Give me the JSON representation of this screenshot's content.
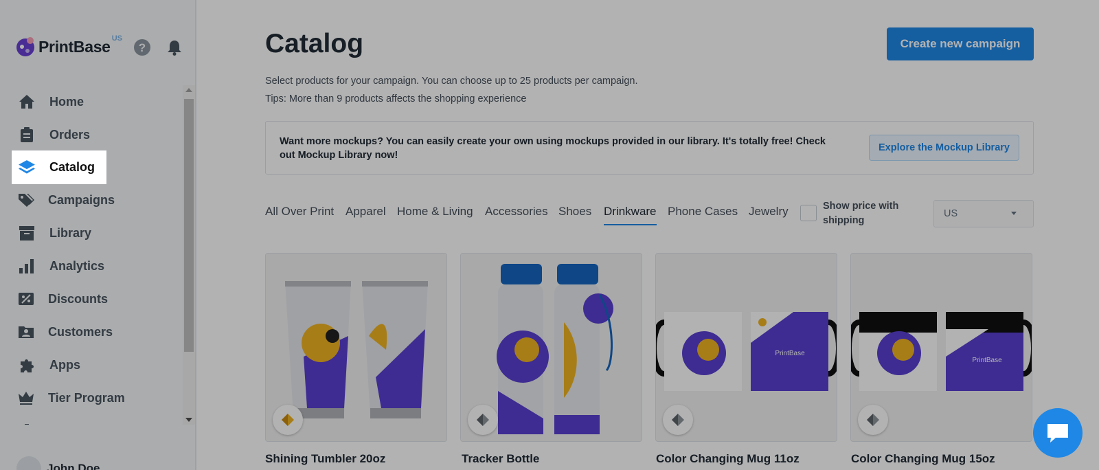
{
  "brand": {
    "name": "PrintBase",
    "region": "US"
  },
  "sidebar": {
    "items": [
      {
        "label": "Home",
        "icon": "home-icon"
      },
      {
        "label": "Orders",
        "icon": "clipboard-icon"
      },
      {
        "label": "Catalog",
        "icon": "layers-icon",
        "active": true
      },
      {
        "label": "Campaigns",
        "icon": "tags-icon"
      },
      {
        "label": "Library",
        "icon": "archive-icon"
      },
      {
        "label": "Analytics",
        "icon": "bar-chart-icon"
      },
      {
        "label": "Discounts",
        "icon": "percent-icon"
      },
      {
        "label": "Customers",
        "icon": "customer-folder-icon"
      },
      {
        "label": "Apps",
        "icon": "puzzle-icon"
      },
      {
        "label": "Tier Program",
        "icon": "crown-icon"
      }
    ],
    "user_name": "John Doe"
  },
  "main": {
    "title": "Catalog",
    "create_button": "Create new campaign",
    "subtitle": "Select products for your campaign. You can choose up to 25 products per campaign.",
    "tips": "Tips: More than 9 products affects the shopping experience",
    "banner": {
      "text": "Want more mockups? You can easily create your own using mockups provided in our library. It's totally free! Check out Mockup Library now!",
      "button": "Explore the Mockup Library"
    },
    "tabs": [
      "All Over Print",
      "Apparel",
      "Home & Living",
      "Accessories",
      "Shoes",
      "Drinkware",
      "Phone Cases",
      "Jewelry"
    ],
    "active_tab": "Drinkware",
    "show_price_label": "Show price with shipping",
    "region_select": "US",
    "products": [
      {
        "title": "Shining Tumbler 20oz",
        "badge": "gold-diamond-icon"
      },
      {
        "title": "Tracker Bottle",
        "badge": "silver-diamond-icon"
      },
      {
        "title": "Color Changing Mug 11oz",
        "badge": "silver-diamond-icon"
      },
      {
        "title": "Color Changing Mug 15oz",
        "badge": "silver-diamond-icon"
      }
    ]
  },
  "colors": {
    "accent": "#1f87e5",
    "brand_purple": "#5a3fd1",
    "gold": "#f0b323"
  }
}
